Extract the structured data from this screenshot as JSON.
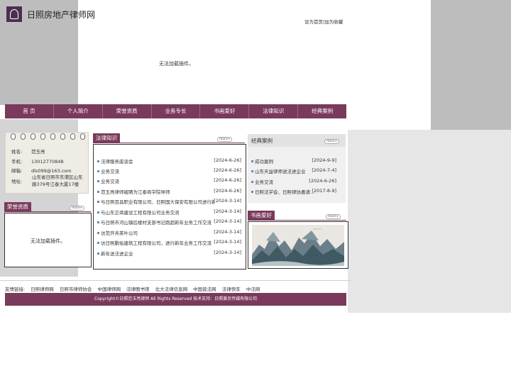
{
  "header": {
    "site_title": "日照房地产律师网",
    "link_home": "设为首页",
    "link_sep": "|",
    "link_fav": "加为收藏"
  },
  "banner": {
    "plugin_message": "无法加载插件。"
  },
  "nav": [
    "首 页",
    "个人简介",
    "荣誉资质",
    "业务专长",
    "书画爱好",
    "法律知识",
    "经典案例"
  ],
  "contact": {
    "name_label": "姓名:",
    "name": "范玉亮",
    "phone_label": "手机:",
    "phone": "13012770848",
    "email_label": "邮箱:",
    "email": "dls099@163.com",
    "address_label": "地址:",
    "address": "山东省日照市东港区山东路379号江泰大厦17楼"
  },
  "honor": {
    "title": "荣誉资质",
    "more": "more+",
    "plugin_message": "无法加载插件。"
  },
  "legal": {
    "title": "法律知识",
    "more": "more+",
    "items": [
      {
        "text": "法律服务座谈会",
        "date": "[2024-6-26]"
      },
      {
        "text": "业务交流",
        "date": "[2024-6-26]"
      },
      {
        "text": "业务交流",
        "date": "[2024-6-26]"
      },
      {
        "text": "范玉亮律师被聘为江泰商学院导师",
        "date": "[2024-6-26]"
      },
      {
        "text": "与日照百昌职业有限公司、日照国大保安有限公司进行新…",
        "date": "[2024-3-14]"
      },
      {
        "text": "与山东正商建设工程有限公司业务交流",
        "date": "[2024-3-14]"
      },
      {
        "text": "与日照市河山镇后楼村支部书记跑超新年业务工作交流",
        "date": "[2024-3-14]"
      },
      {
        "text": "访范开兵茶叶公司",
        "date": "[2024-3-14]"
      },
      {
        "text": "访日照鹏佑建筑工程有限公司，进行新年业务工作交流",
        "date": "[2024-3-14]"
      },
      {
        "text": "新年送法进企业",
        "date": "[2024-3-14]"
      }
    ]
  },
  "cases": {
    "title": "经典案例",
    "more": "more+",
    "items": [
      {
        "text": "成功案例",
        "date": "[2024-9-9]"
      },
      {
        "text": "山东天益律师送法进企业",
        "date": "[2024-7-4]"
      },
      {
        "text": "业务交流",
        "date": "[2024-6-26]"
      },
      {
        "text": "日照法学会、日照律协邀请…",
        "date": "[2017-8-9]"
      }
    ]
  },
  "hobby": {
    "title": "书画爱好",
    "more": "more+"
  },
  "friend_links": {
    "label": "友情链接:",
    "items": [
      "日照律师网",
      "日照市律师协会",
      "中国律师网",
      "法律图书馆",
      "北大法律信息网",
      "中国普法网",
      "法律快车",
      "中法网"
    ]
  },
  "footer": {
    "text": "Copyright©日照范玉亮律师 All Rights Reserved   技术支持：日照黄页传媒有限公司"
  },
  "colors": {
    "brand": "#7a3a5c",
    "bullet": "#6a8ab0"
  }
}
